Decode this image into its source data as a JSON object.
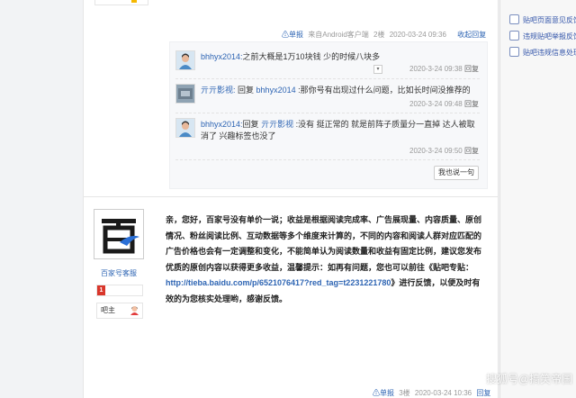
{
  "sidebar_links": [
    {
      "label": "贴吧页面意见反馈",
      "icon": "feedback-icon"
    },
    {
      "label": "违规贴吧举报反馈",
      "icon": "report-icon"
    },
    {
      "label": "贴吧违规信息处理",
      "icon": "violation-icon"
    }
  ],
  "post1": {
    "report": "单报",
    "source": "来自Android客户端",
    "floor": "2楼",
    "time": "2020-03-24 09:36",
    "collapse": "收起回复"
  },
  "replies": [
    {
      "user": "bhhyx2014:",
      "text": "之前大概是1万10块钱 少的时候八块多",
      "time": "2020-3-24 09:38",
      "action": "回复"
    },
    {
      "user": "亓亓影视:",
      "text_prefix": "回复 ",
      "reply_to": "bhhyx2014",
      "text": " :那你号有出现过什么问题，比如长时间没推荐的",
      "time": "2020-3-24 09:48",
      "action": "回复"
    },
    {
      "user": "bhhyx2014:",
      "text_prefix": "回复 ",
      "reply_to": "亓亓影视",
      "text": " :没有 挺正常的 就是前阵子质量分一直掉 达人被取消了 兴趣标签也没了",
      "time": "2020-3-24 09:50",
      "action": "回复"
    }
  ],
  "say_button": "我也说一句",
  "post2": {
    "username": "百家号客服",
    "level": "1",
    "role": "吧主",
    "content": "亲，您好，百家号没有单价一说；收益是根据阅读完成率、广告展现量、内容质量、原创情况、粉丝阅读比例、互动数据等多个维度来计算的，不同的内容和阅读人群对应匹配的广告价格也会有一定调整和变化，不能简单认为阅读数量和收益有固定比例，建议您发布优质的原创内容以获得更多收益，温馨提示：如再有问题，您也可以前往《贴吧专贴：",
    "link": "http://tieba.baidu.com/p/6521076417?red_tag=t2231221780",
    "content_after": "》进行反馈，以便及时有效的为您核实处理哟，感谢反馈。",
    "report": "单报",
    "floor": "3楼",
    "time": "2020-03-24 10:36",
    "reply": "回复"
  },
  "watermark": "搜狐号@搞笑帝国"
}
